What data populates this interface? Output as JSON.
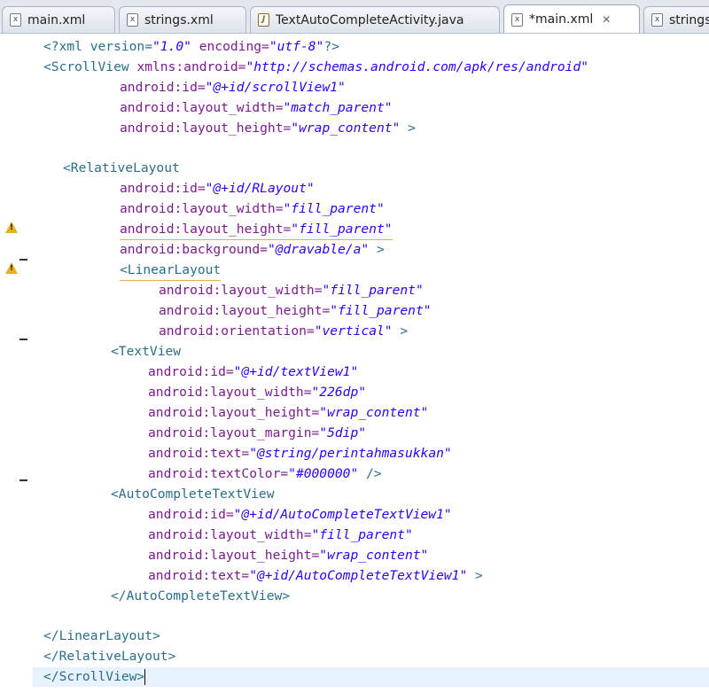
{
  "tabs": [
    {
      "label": "main.xml",
      "icon": "xml-file-icon"
    },
    {
      "label": "strings.xml",
      "icon": "xml-file-icon"
    },
    {
      "label": "TextAutoCompleteActivity.java",
      "icon": "java-file-icon"
    },
    {
      "label": "*main.xml",
      "icon": "xml-file-icon",
      "active": true
    },
    {
      "label": "strings",
      "icon": "xml-file-icon"
    }
  ],
  "code": {
    "l1": [
      "<?xml version=",
      "\"1.0\"",
      " encoding=",
      "\"utf-8\"",
      "?>"
    ],
    "l2": [
      "<ScrollView",
      " xmlns:android=",
      "\"http://schemas.android.com/apk/res/android\""
    ],
    "l3": [
      "android:id=",
      "\"@+id/scrollView1\""
    ],
    "l4": [
      "android:layout_width=",
      "\"match_parent\""
    ],
    "l5": [
      "android:layout_height=",
      "\"wrap_content\"",
      " >"
    ],
    "l7": [
      "<RelativeLayout"
    ],
    "l8": [
      "android:id=",
      "\"@+id/RLayout\""
    ],
    "l9": [
      "android:layout_width=",
      "\"fill_parent\""
    ],
    "l10": [
      "android:layout_height=",
      "\"fill_parent\""
    ],
    "l11": [
      "android:background=",
      "\"@dravable/a\"",
      " >"
    ],
    "l12": [
      "<LinearLayout"
    ],
    "l13": [
      "android:layout_width=",
      "\"fill_parent\""
    ],
    "l14": [
      "android:layout_height=",
      "\"fill_parent\""
    ],
    "l15": [
      "android:orientation=",
      "\"vertical\"",
      " >"
    ],
    "l16": [
      "<TextView"
    ],
    "l17": [
      "android:id=",
      "\"@+id/textView1\""
    ],
    "l18": [
      "android:layout_width=",
      "\"226dp\""
    ],
    "l19": [
      "android:layout_height=",
      "\"wrap_content\""
    ],
    "l20": [
      "android:layout_margin=",
      "\"5dip\""
    ],
    "l21": [
      "android:text=",
      "\"@string/perintahmasukkan\""
    ],
    "l22": [
      "android:textColor=",
      "\"#000000\"",
      " />"
    ],
    "l23": [
      "<AutoCompleteTextView"
    ],
    "l24": [
      "android:id=",
      "\"@+id/AutoCompleteTextView1\""
    ],
    "l25": [
      "android:layout_width=",
      "\"fill_parent\""
    ],
    "l26": [
      "android:layout_height=",
      "\"wrap_content\""
    ],
    "l27": [
      "android:text=",
      "\"@+id/AutoCompleteTextView1\"",
      " >"
    ],
    "l28": [
      "</AutoCompleteTextView>"
    ],
    "l30": [
      "</LinearLayout>"
    ],
    "l31": [
      "</RelativeLayout>"
    ],
    "l32": [
      "</ScrollView>"
    ]
  }
}
